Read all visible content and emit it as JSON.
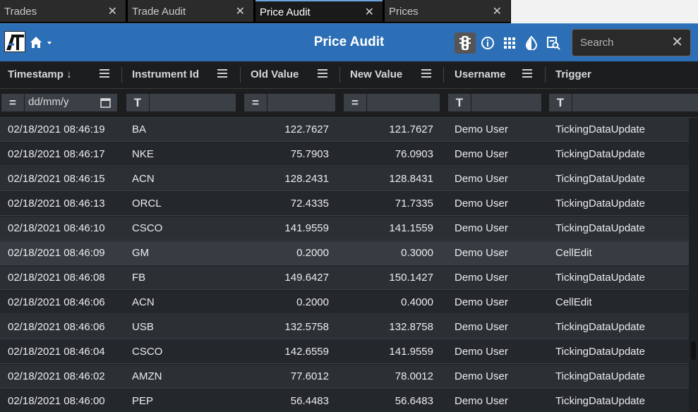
{
  "tabs": [
    {
      "label": "Trades",
      "active": false
    },
    {
      "label": "Trade Audit",
      "active": false
    },
    {
      "label": "Price Audit",
      "active": true
    },
    {
      "label": "Prices",
      "active": false
    }
  ],
  "header": {
    "title": "Price Audit",
    "search_placeholder": "Search",
    "icons": [
      "app-logo-icon",
      "home-icon",
      "chevron-down-icon",
      "traffic-light-icon",
      "info-icon",
      "grid-apps-icon",
      "contrast-icon",
      "search-document-icon",
      "clear-search-icon"
    ]
  },
  "columns": [
    {
      "name": "Timestamp",
      "sort": "desc",
      "filter_type": "=",
      "filter_placeholder": "dd/mm/y"
    },
    {
      "name": "Instrument Id",
      "filter_type": "T"
    },
    {
      "name": "Old Value",
      "filter_type": "="
    },
    {
      "name": "New Value",
      "filter_type": "="
    },
    {
      "name": "Username",
      "filter_type": "T"
    },
    {
      "name": "Trigger",
      "filter_type": "T"
    }
  ],
  "rows": [
    {
      "ts": "02/18/2021 08:46:19",
      "inst": "BA",
      "old": "122.7627",
      "new": "121.7627",
      "user": "Demo User",
      "trigger": "TickingDataUpdate"
    },
    {
      "ts": "02/18/2021 08:46:17",
      "inst": "NKE",
      "old": "75.7903",
      "new": "76.0903",
      "user": "Demo User",
      "trigger": "TickingDataUpdate"
    },
    {
      "ts": "02/18/2021 08:46:15",
      "inst": "ACN",
      "old": "128.2431",
      "new": "128.8431",
      "user": "Demo User",
      "trigger": "TickingDataUpdate"
    },
    {
      "ts": "02/18/2021 08:46:13",
      "inst": "ORCL",
      "old": "72.4335",
      "new": "71.7335",
      "user": "Demo User",
      "trigger": "TickingDataUpdate"
    },
    {
      "ts": "02/18/2021 08:46:10",
      "inst": "CSCO",
      "old": "141.9559",
      "new": "141.1559",
      "user": "Demo User",
      "trigger": "TickingDataUpdate"
    },
    {
      "ts": "02/18/2021 08:46:09",
      "inst": "GM",
      "old": "0.2000",
      "new": "0.3000",
      "user": "Demo User",
      "trigger": "CellEdit"
    },
    {
      "ts": "02/18/2021 08:46:08",
      "inst": "FB",
      "old": "149.6427",
      "new": "150.1427",
      "user": "Demo User",
      "trigger": "TickingDataUpdate"
    },
    {
      "ts": "02/18/2021 08:46:06",
      "inst": "ACN",
      "old": "0.2000",
      "new": "0.4000",
      "user": "Demo User",
      "trigger": "CellEdit"
    },
    {
      "ts": "02/18/2021 08:46:06",
      "inst": "USB",
      "old": "132.5758",
      "new": "132.8758",
      "user": "Demo User",
      "trigger": "TickingDataUpdate"
    },
    {
      "ts": "02/18/2021 08:46:04",
      "inst": "CSCO",
      "old": "142.6559",
      "new": "141.9559",
      "user": "Demo User",
      "trigger": "TickingDataUpdate"
    },
    {
      "ts": "02/18/2021 08:46:02",
      "inst": "AMZN",
      "old": "77.6012",
      "new": "78.0012",
      "user": "Demo User",
      "trigger": "TickingDataUpdate"
    },
    {
      "ts": "02/18/2021 08:46:00",
      "inst": "PEP",
      "old": "56.4483",
      "new": "56.6483",
      "user": "Demo User",
      "trigger": "TickingDataUpdate"
    }
  ],
  "colors": {
    "header_bar": "#2c6fb6",
    "row_odd": "#2b3035",
    "row_even": "#24282c",
    "tab_accent": "#6aa5e0"
  }
}
